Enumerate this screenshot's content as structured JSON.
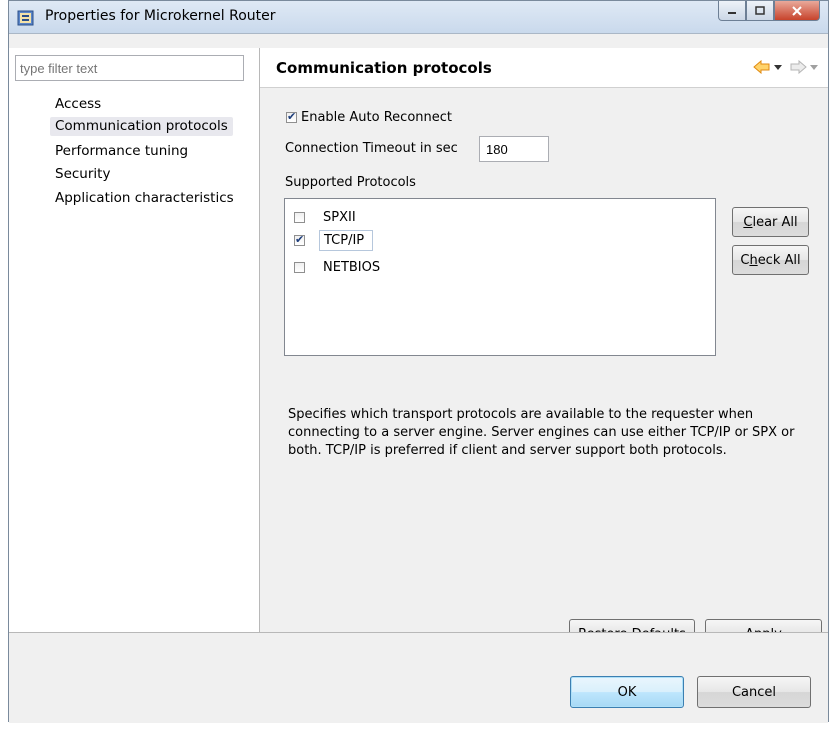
{
  "window": {
    "title": "Properties for Microkernel Router"
  },
  "sidebar": {
    "filter_placeholder": "type filter text",
    "items": [
      {
        "label": "Access"
      },
      {
        "label": "Communication protocols"
      },
      {
        "label": "Performance tuning"
      },
      {
        "label": "Security"
      },
      {
        "label": "Application characteristics"
      }
    ]
  },
  "page": {
    "title": "Communication protocols",
    "enable_auto_reconnect": {
      "label": "Enable Auto Reconnect",
      "checked": true
    },
    "connection_timeout": {
      "label": "Connection Timeout in sec",
      "value": "180"
    },
    "supported_protocols_label": "Supported Protocols",
    "protocols": [
      {
        "label": "SPXII",
        "checked": false
      },
      {
        "label": "TCP/IP",
        "checked": true
      },
      {
        "label": "NETBIOS",
        "checked": false
      }
    ],
    "clear_all": {
      "prefix": "",
      "mnemonic": "C",
      "suffix": "lear All"
    },
    "check_all": {
      "prefix": "C",
      "mnemonic": "h",
      "suffix": "eck All"
    },
    "description": "Specifies which transport protocols are available to the requester when connecting to a server engine. Server engines can use either TCP/IP or SPX or both. TCP/IP is preferred if client and server support both protocols.",
    "restore_defaults": {
      "prefix": "Restore ",
      "mnemonic": "D",
      "suffix": "efaults"
    },
    "apply": {
      "prefix": "",
      "mnemonic": "A",
      "suffix": "pply"
    }
  },
  "footer": {
    "ok": "OK",
    "cancel": "Cancel"
  },
  "colors": {
    "nav_back": "#f0a020",
    "nav_disabled": "#c0c0c0",
    "title_gradient": "#c9d9ec",
    "close": "#c7432b"
  }
}
